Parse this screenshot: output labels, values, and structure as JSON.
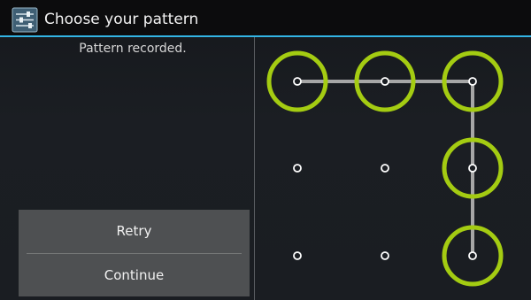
{
  "action_bar": {
    "title": "Choose your pattern",
    "icon": "settings-sliders-icon"
  },
  "header": {
    "message": "Pattern recorded."
  },
  "buttons": {
    "retry_label": "Retry",
    "continue_label": "Continue"
  },
  "pattern": {
    "grid_size": 3,
    "selected_dots": [
      1,
      2,
      3,
      6,
      9
    ],
    "colors": {
      "ring": "#a4cc12",
      "line": "#a6a6a6",
      "dot": "#ffffff",
      "accent": "#33b5e5"
    }
  }
}
